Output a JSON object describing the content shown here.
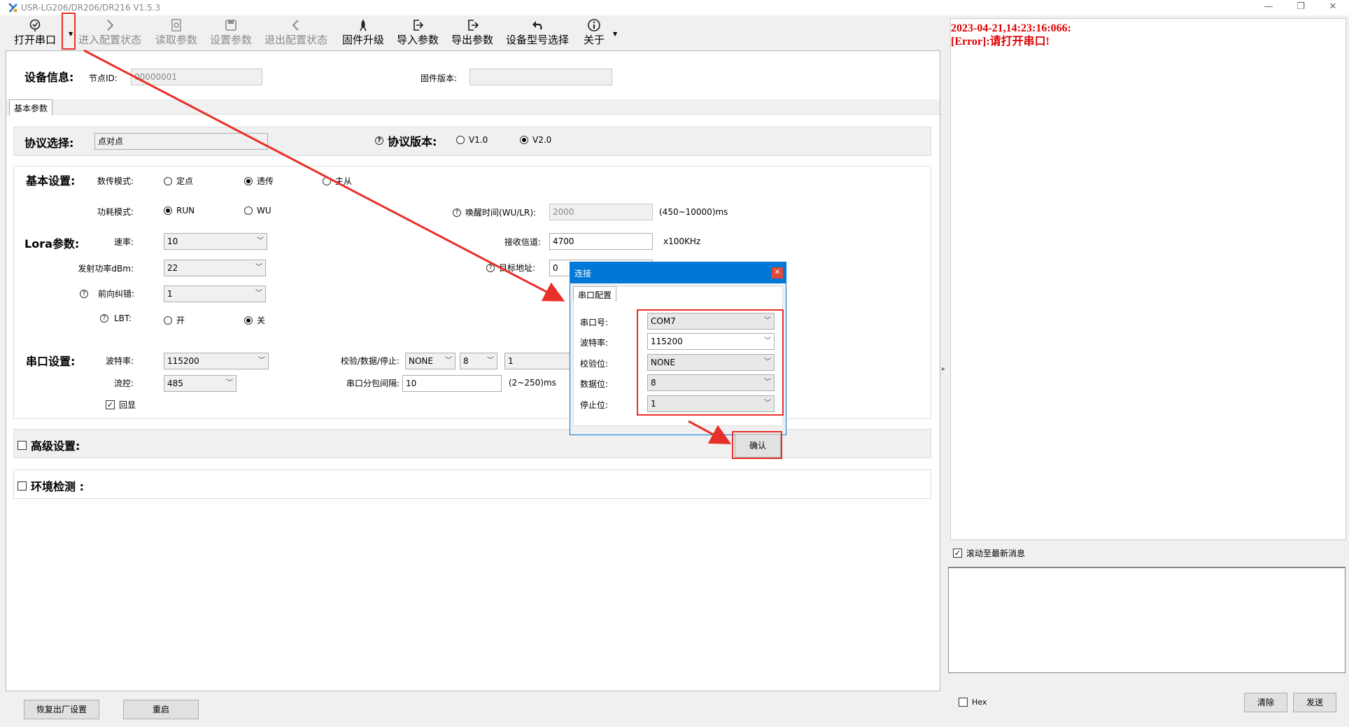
{
  "window": {
    "title": "USR-LG206/DR206/DR216 V1.5.3",
    "controls": [
      "—",
      "❐",
      "✕"
    ]
  },
  "toolbar": {
    "open_port": "打开串口",
    "enter_config": "进入配置状态",
    "read_params": "读取参数",
    "set_params": "设置参数",
    "exit_config": "退出配置状态",
    "firmware_upgrade": "固件升级",
    "import_params": "导入参数",
    "export_params": "导出参数",
    "device_model": "设备型号选择",
    "about": "关于"
  },
  "device_info": {
    "label": "设备信息:",
    "node_id_label": "节点ID:",
    "node_id_value": "00000001",
    "firmware_label": "固件版本:",
    "firmware_value": ""
  },
  "tabs": {
    "basic": "基本参数"
  },
  "protocol": {
    "label": "协议选择:",
    "value": "点对点",
    "version_label": "协议版本:",
    "v1": "V1.0",
    "v2": "V2.0",
    "selected": "V2.0"
  },
  "basic": {
    "label": "基本设置:",
    "mode_label": "数传模式:",
    "mode_fixed": "定点",
    "mode_transparent": "透传",
    "mode_master": "主从",
    "power_label": "功耗模式:",
    "power_run": "RUN",
    "power_wu": "WU",
    "wake_label": "唤醒时间(WU/LR):",
    "wake_value": "2000",
    "wake_range": "(450~10000)ms"
  },
  "lora": {
    "label": "Lora参数:",
    "rate_label": "速率:",
    "rate_value": "10",
    "channel_label": "接收信道:",
    "channel_value": "4700",
    "channel_unit": "x100KHz",
    "tx_power_label": "发射功率dBm:",
    "tx_power_value": "22",
    "target_label": "目标地址:",
    "target_value": "0",
    "fec_label": "前向纠错:",
    "fec_value": "1",
    "lbt_label": "LBT:",
    "lbt_on": "开",
    "lbt_off": "关"
  },
  "serial": {
    "label": "串口设置:",
    "baud_label": "波特率:",
    "baud_value": "115200",
    "parity_label": "校验/数据/停止:",
    "parity_value": "NONE",
    "data_value": "8",
    "stop_value": "1",
    "flow_label": "流控:",
    "flow_value": "485",
    "interval_label": "串口分包间隔:",
    "interval_value": "10",
    "interval_range": "(2~250)ms",
    "echo_label": "回显"
  },
  "advanced": {
    "label": "高级设置:"
  },
  "env": {
    "label": "环境检测 :"
  },
  "bottom": {
    "factory_reset": "恢复出厂设置",
    "restart": "重启"
  },
  "dialog": {
    "title": "连接",
    "tab": "串口配置",
    "port_label": "串口号:",
    "port_value": "COM7",
    "baud_label": "波特率:",
    "baud_value": "115200",
    "parity_label": "校验位:",
    "parity_value": "NONE",
    "data_label": "数据位:",
    "data_value": "8",
    "stop_label": "停止位:",
    "stop_value": "1",
    "confirm": "确认"
  },
  "log": {
    "line1": "2023-04-21,14:23:16:066:",
    "line2": "[Error]:请打开串口!",
    "scroll_latest": "滚动至最新消息",
    "hex": "Hex",
    "clear": "清除",
    "send": "发送"
  },
  "colors": {
    "accent": "#0078d7",
    "error": "#e00000",
    "annotation": "#e8302a"
  }
}
